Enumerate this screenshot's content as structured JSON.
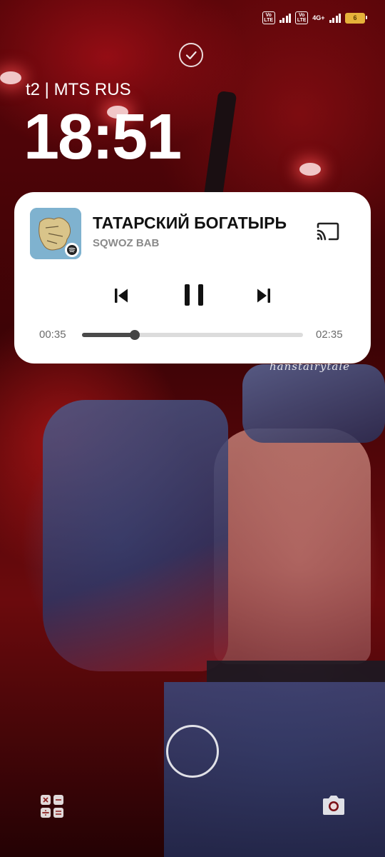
{
  "status_bar": {
    "volte1": [
      "Vo",
      "LTE"
    ],
    "volte2": [
      "Vo",
      "LTE"
    ],
    "network": "4G+",
    "battery": "6",
    "accent": "#e6b23a"
  },
  "lockscreen": {
    "carrier": "t2 | MTS RUS",
    "time": "18:51",
    "watermark": "hanstairytale"
  },
  "media": {
    "title": "ТАТАРСКИЙ БОГАТЫРЬ",
    "artist": "SQWOZ BAB",
    "elapsed": "00:35",
    "total": "02:35",
    "progress": 0.24,
    "controls": [
      "previous-icon",
      "pause-icon",
      "next-icon"
    ],
    "cast_icon": "cast-icon",
    "art_badge": "spotify-icon"
  },
  "shortcuts": {
    "left": "calculator-icon",
    "center": "fingerprint-sensor",
    "right": "camera-icon"
  }
}
